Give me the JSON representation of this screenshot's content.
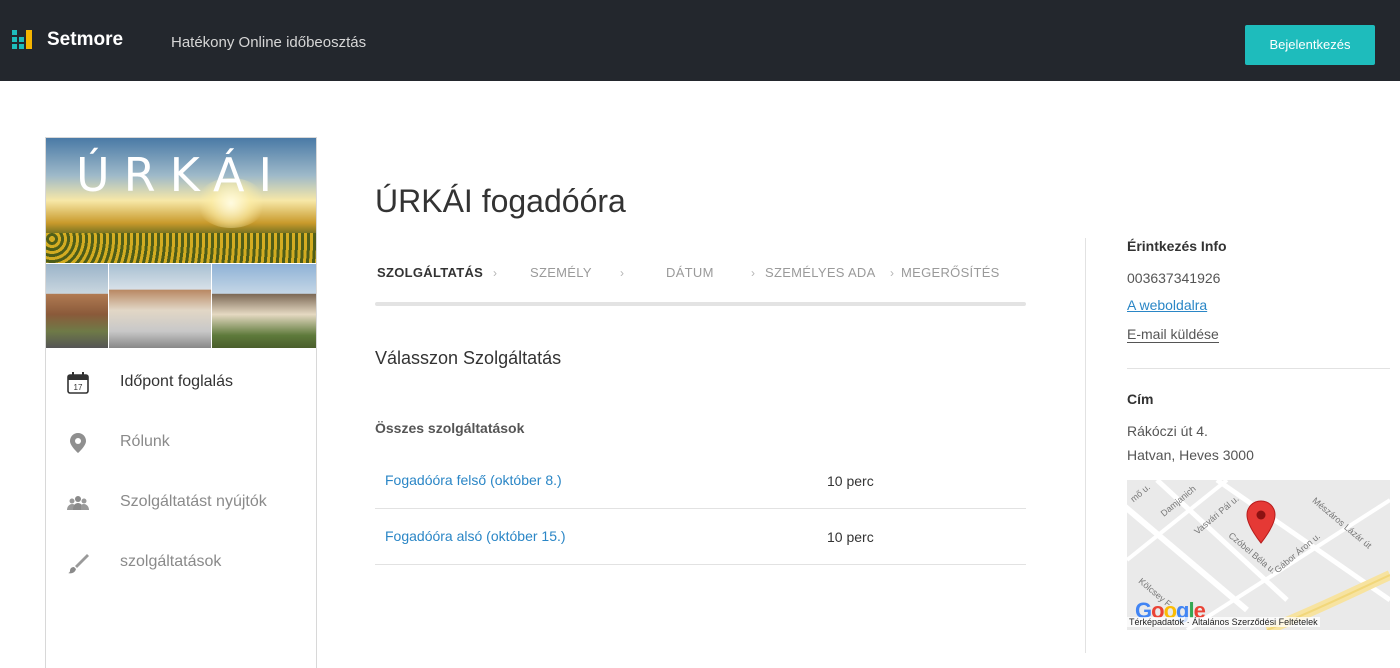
{
  "topbar": {
    "brand": "Setmore",
    "tagline": "Hatékony Online időbeosztás",
    "login_label": "Bejelentkezés",
    "accent_color": "#1ebcbc"
  },
  "sidebar": {
    "banner_title": "ÚRKÁI",
    "items": [
      {
        "label": "Időpont foglalás",
        "icon": "calendar-icon",
        "calendar_day": "17"
      },
      {
        "label": "Rólunk",
        "icon": "map-pin-icon"
      },
      {
        "label": "Szolgáltatást nyújtók",
        "icon": "people-icon"
      },
      {
        "label": "szolgáltatások",
        "icon": "brush-icon"
      }
    ]
  },
  "main": {
    "title": "ÚRKÁI fogadóóra",
    "steps": [
      "SZOLGÁLTATÁS",
      "SZEMÉLY",
      "DÁTUM",
      "SZEMÉLYES ADA",
      "MEGERŐSÍTÉS"
    ],
    "active_step": "SZOLGÁLTATÁS",
    "section_title": "Válasszon Szolgáltatás",
    "group_title": "Összes szolgáltatások",
    "services": [
      {
        "name": "Fogadóóra felső (október 8.)",
        "duration": "10 perc"
      },
      {
        "name": "Fogadóóra alsó (október 15.)",
        "duration": "10 perc"
      }
    ]
  },
  "contact": {
    "heading": "Érintkezés Info",
    "phone": "003637341926",
    "website_link": "A weboldalra",
    "email_link": "E-mail küldése",
    "address_heading": "Cím",
    "address_line1": "Rákóczi út 4.",
    "address_line2": "Hatvan, Heves 3000",
    "map": {
      "streets": [
        "Damjanich",
        "Vasvári Pál u.",
        "Czóbel Béla u.",
        "Gábor Áron u.",
        "Mészáros Lázár út",
        "Kölcsey F."
      ],
      "google_logo": "Google",
      "attribution": "Térképadatok",
      "terms": "Általános Szerződési Feltételek"
    }
  }
}
